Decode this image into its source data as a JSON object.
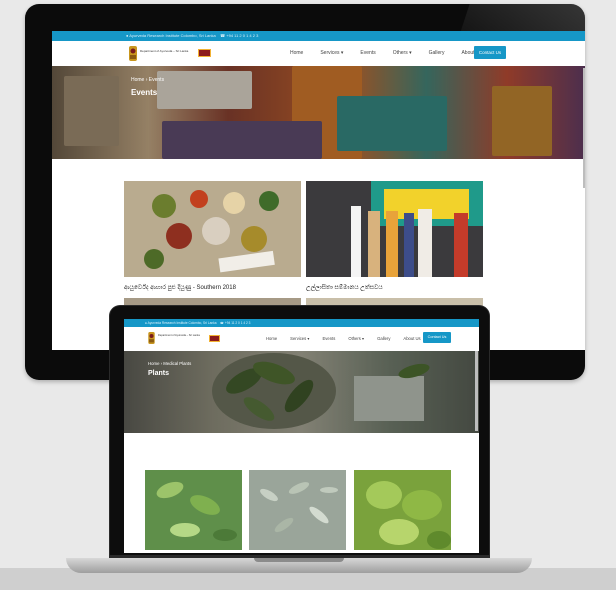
{
  "desktop": {
    "topbar_text": "● Ayurveda Research Institute Colombo, Sri Lanka    ☎ +94 11 2 0 1 4 2 3",
    "org_name": "Department of Ayurveda – Sri Lanka",
    "nav": [
      "Home",
      "Services ▾",
      "Events",
      "Others ▾",
      "Gallery",
      "About Us"
    ],
    "contact_button": "Contact Us",
    "breadcrumb": "Home  ›  Events",
    "page_title": "Events",
    "cards": [
      {
        "caption": "ආයුර්වේද ආහාර පුළු දියුණු - Southern 2018"
      },
      {
        "caption": "උල්ලාසිතා සම්මානය උත්සවය"
      }
    ]
  },
  "laptop": {
    "topbar_text": "● Ayurveda Research Institute Colombo, Sri Lanka    ☎ +94 11 2 0 1 4 2 3",
    "org_name": "Department of Ayurveda – Sri Lanka",
    "nav": [
      "Home",
      "Services ▾",
      "Events",
      "Others ▾",
      "Gallery",
      "About Us"
    ],
    "contact_button": "Contact Us",
    "breadcrumb": "Home  ›  Medical Plants",
    "page_title": "Plants"
  },
  "colors": {
    "accent": "#1697c7",
    "background": "#e9e9e9",
    "device": "#0b0b0b"
  }
}
